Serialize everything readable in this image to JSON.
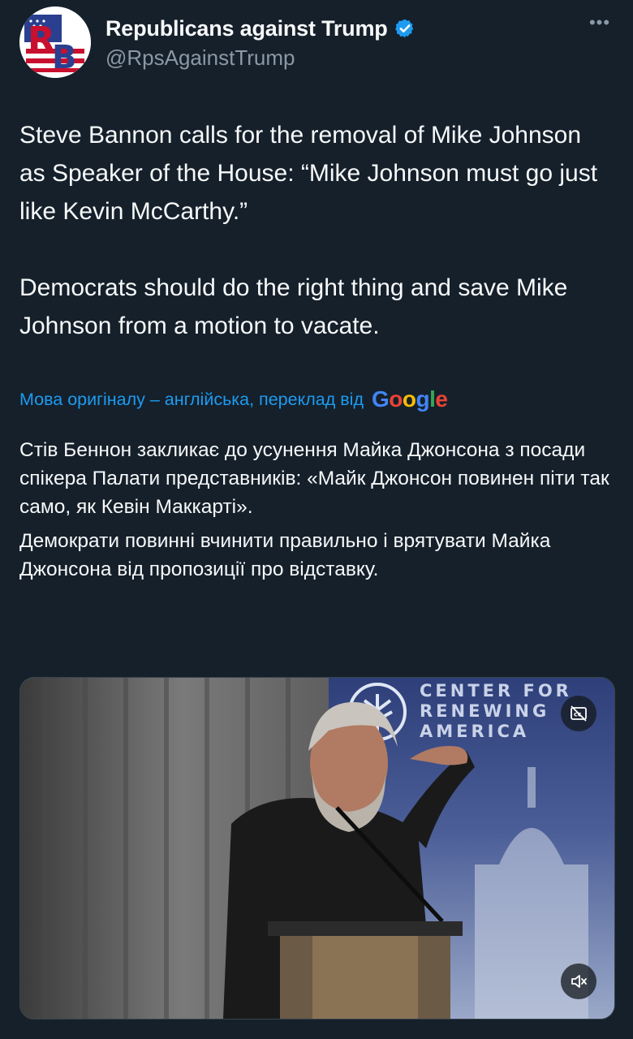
{
  "author": {
    "display_name": "Republicans against Trump",
    "handle": "@RpsAgainstTrump",
    "avatar_letters": "RB",
    "verified": true
  },
  "tweet": {
    "paragraphs": [
      "Steve Bannon calls for the removal of Mike Johnson as Speaker of the House: “Mike Johnson must go just like Kevin McCarthy.”",
      "Democrats should do the right thing and save Mike Johnson from a motion to vacate."
    ]
  },
  "translation": {
    "label": "Мова оригіналу – англійська, переклад від",
    "provider": "Google",
    "paragraphs": [
      "Стів Беннон закликає до усунення Майка Джонсона з посади спікера Палати представників: «Майк Джонсон повинен піти так само, як Кевін Маккарті».",
      "Демократи повинні вчинити правильно і врятувати Майка Джонсона від пропозиції про відставку."
    ]
  },
  "video": {
    "banner_lines": [
      "CENTER FOR",
      "RENEWING",
      "AMERICA"
    ],
    "cc_icon": "closed-captions-off-icon",
    "mute_icon": "speaker-muted-icon"
  },
  "colors": {
    "background": "#15202b",
    "link": "#1d9bf0",
    "verified": "#1d9bf0",
    "secondary_text": "#8b98a5"
  }
}
